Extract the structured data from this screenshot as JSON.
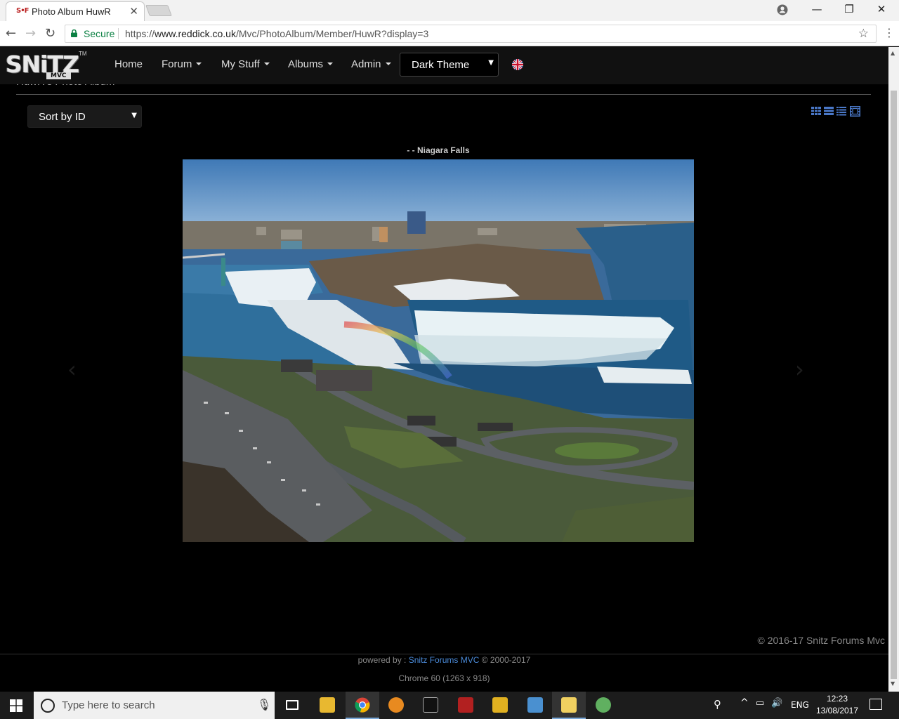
{
  "browser": {
    "tab_favicon": "S•F",
    "tab_title": "Photo Album HuwR",
    "tab_close": "✕",
    "secure_label": "Secure",
    "url_scheme": "https://",
    "url_host": "www.reddick.co.uk",
    "url_path": "/Mvc/PhotoAlbum/Member/HuwR?display=3",
    "minimize": "—",
    "maximize": "❐",
    "close": "✕",
    "back": "←",
    "forward": "→",
    "reload": "↻",
    "star": "☆",
    "menu": "⋮"
  },
  "site": {
    "logo_text": "SNiTZ",
    "logo_sub": "MVC",
    "logo_tm": "TM",
    "nav": {
      "home": "Home",
      "forum": "Forum",
      "my_stuff": "My Stuff",
      "albums": "Albums",
      "admin": "Admin"
    },
    "theme_select": "Dark Theme",
    "page_title": "HuwR's Photo Album",
    "sort_select": "Sort by ID",
    "photo_caption": "- - Niagara Falls",
    "prev": "‹",
    "next": "›"
  },
  "footer": {
    "copyright": "© 2016-17 Snitz Forums Mvc",
    "powered_prefix": "powered by : ",
    "powered_link": "Snitz Forums MVC",
    "powered_suffix": " © 2000-2017",
    "browser_info": "Chrome 60 (1263 x 918)"
  },
  "taskbar": {
    "search_placeholder": "Type here to search",
    "lang": "ENG",
    "time": "12:23",
    "date": "13/08/2017"
  },
  "colors": {
    "accent_link": "#4a8ad8",
    "nav_bg": "#111111",
    "page_bg": "#000000",
    "view_icon_blue": "#4a78c8"
  }
}
